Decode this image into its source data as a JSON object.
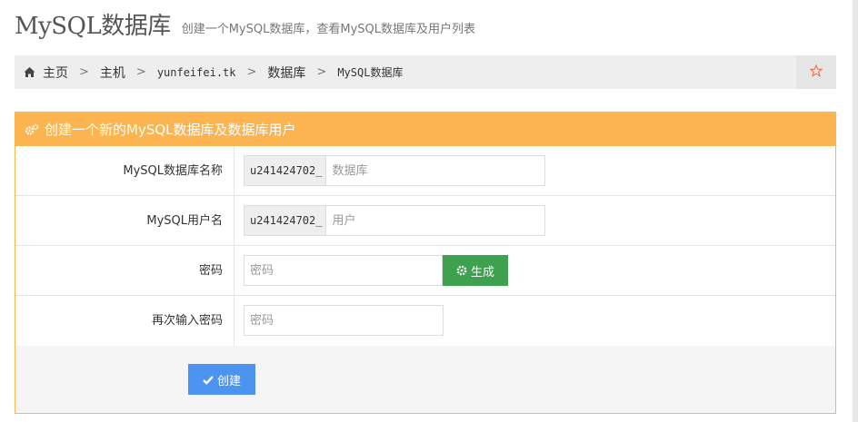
{
  "header": {
    "title": "MySQL数据库",
    "subtitle": "创建一个MySQL数据库，查看MySQL数据库及用户列表"
  },
  "breadcrumb": {
    "home": "主页",
    "separator": ">",
    "items": [
      "主机",
      "yunfeifei.tk",
      "数据库",
      "MySQL数据库"
    ]
  },
  "panel": {
    "heading": "创建一个新的MySQL数据库及数据库用户",
    "accent_color": "#fbb450"
  },
  "form": {
    "db_name": {
      "label": "MySQL数据库名称",
      "prefix": "u241424702_",
      "placeholder": "数据库",
      "value": ""
    },
    "db_user": {
      "label": "MySQL用户名",
      "prefix": "u241424702_",
      "placeholder": "用户",
      "value": ""
    },
    "password": {
      "label": "密码",
      "placeholder": "密码",
      "value": "",
      "generate_label": "生成"
    },
    "password_confirm": {
      "label": "再次输入密码",
      "placeholder": "密码",
      "value": ""
    }
  },
  "actions": {
    "create_label": "创建",
    "create_color": "#4d94f0",
    "generate_color": "#3da14f"
  },
  "icons": {
    "home": "home-icon",
    "favorite": "star-icon",
    "panel": "cogs-icon",
    "generate": "gear-icon",
    "create": "check-icon"
  }
}
